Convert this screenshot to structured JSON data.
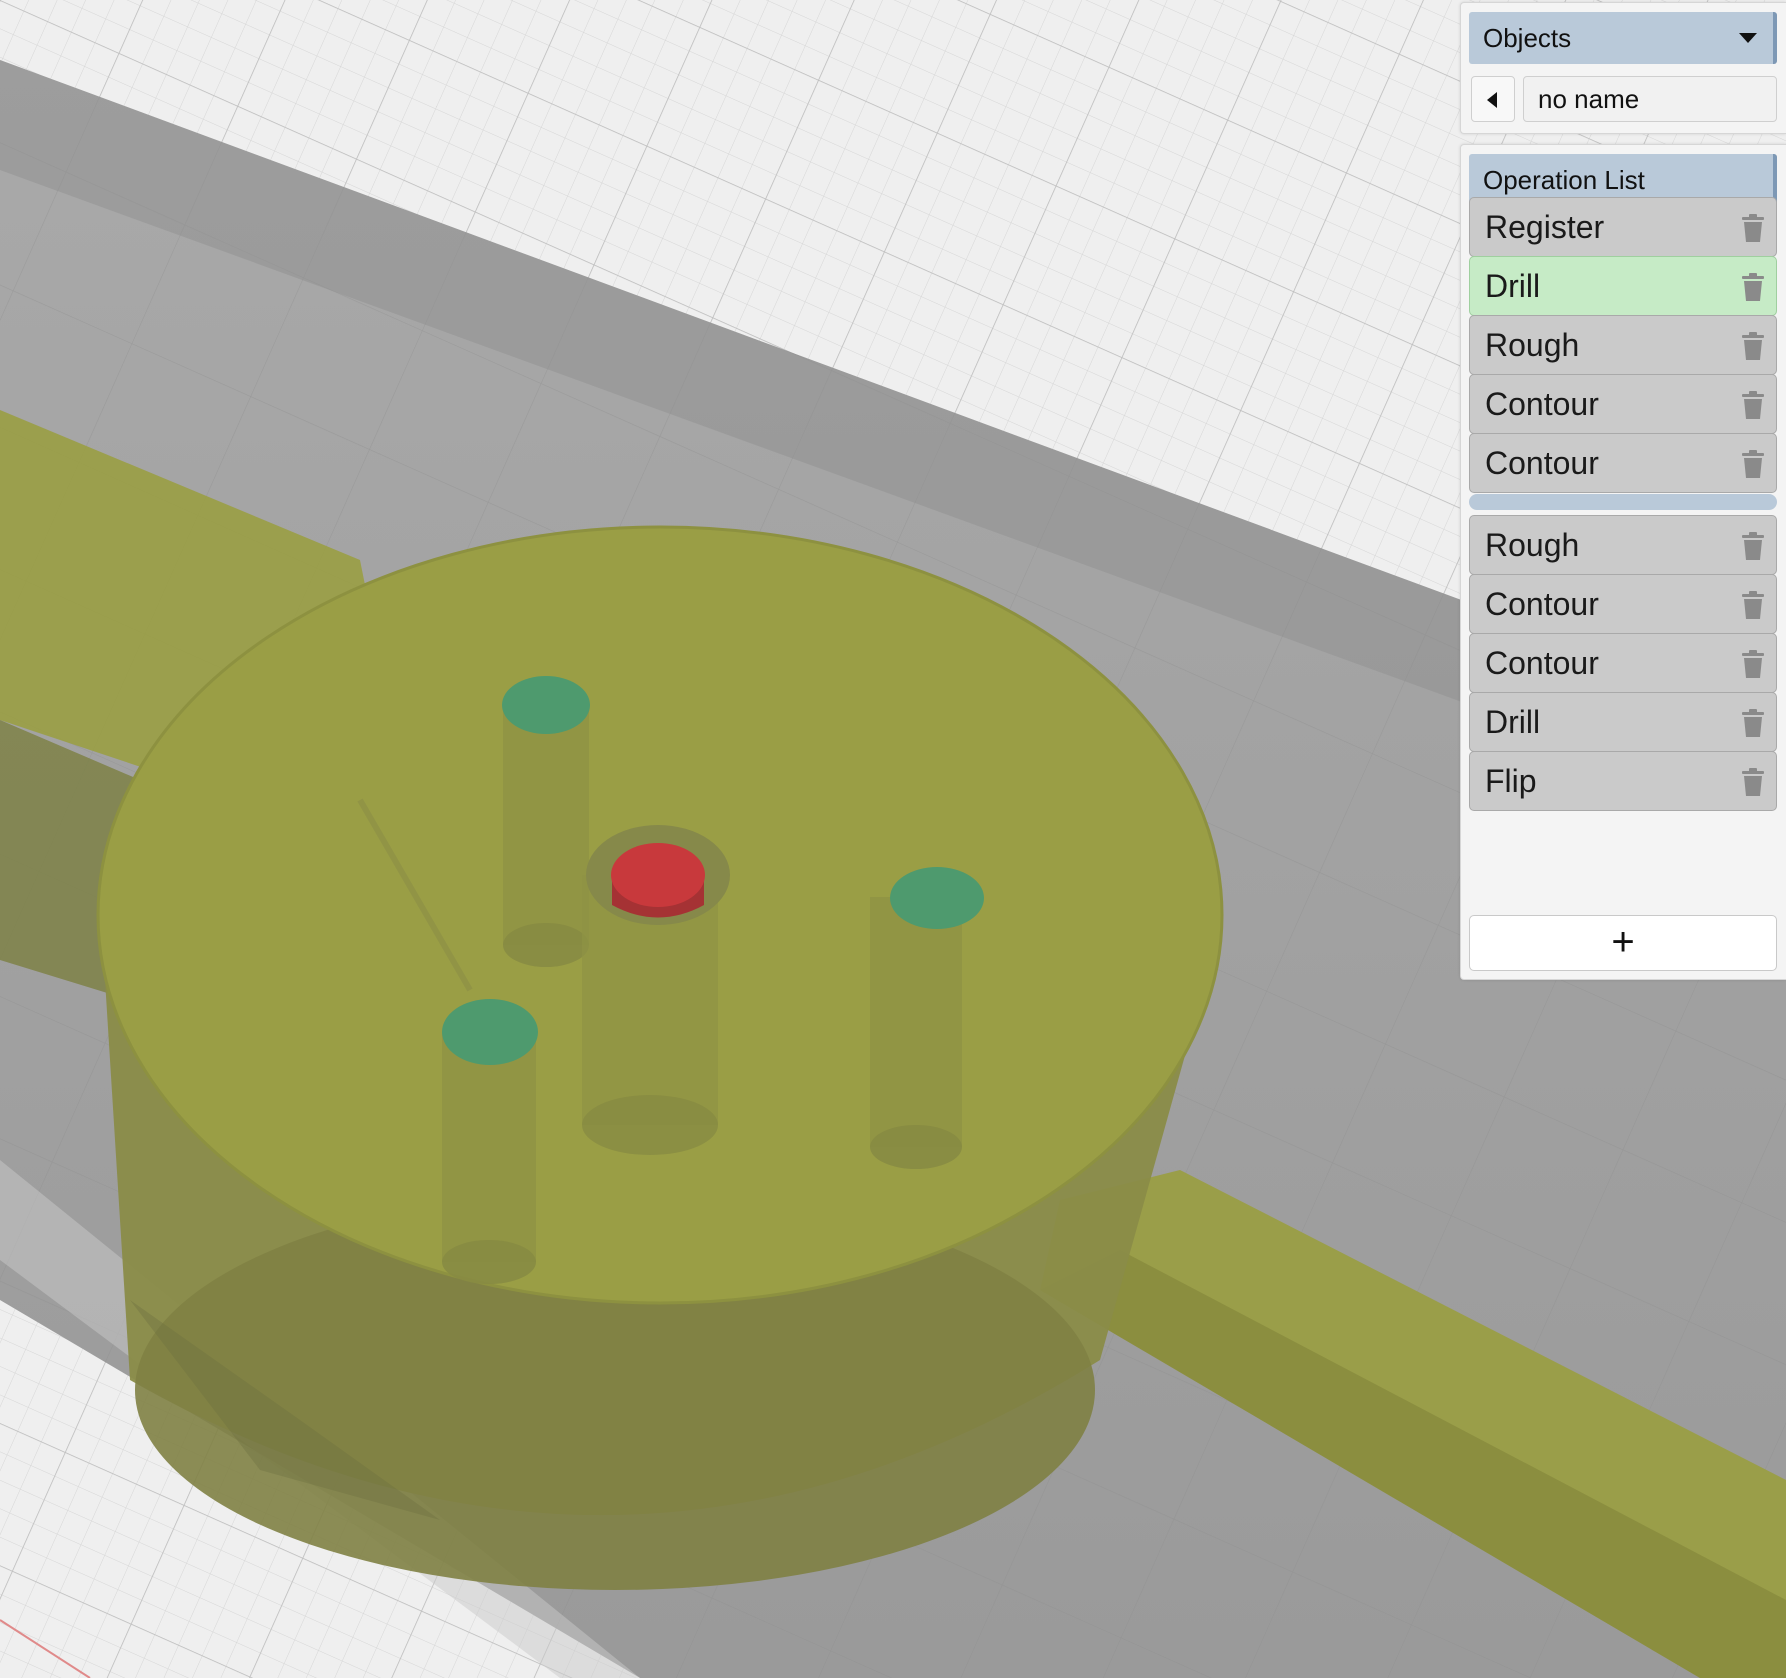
{
  "objects_panel": {
    "title": "Objects",
    "dropdown_icon": "caret-down-icon",
    "prev_icon": "caret-left-icon",
    "name_value": "no name"
  },
  "operations_panel": {
    "title": "Operation List",
    "add_label": "+",
    "delete_icon": "trash-icon",
    "active_color": "#c6ebc6",
    "groups": [
      {
        "items": [
          {
            "label": "Register",
            "active": false
          },
          {
            "label": "Drill",
            "active": true
          },
          {
            "label": "Rough",
            "active": false
          },
          {
            "label": "Contour",
            "active": false
          },
          {
            "label": "Contour",
            "active": false
          }
        ]
      },
      {
        "items": [
          {
            "label": "Rough",
            "active": false
          },
          {
            "label": "Contour",
            "active": false
          },
          {
            "label": "Contour",
            "active": false
          },
          {
            "label": "Drill",
            "active": false
          },
          {
            "label": "Flip",
            "active": false
          }
        ]
      }
    ]
  },
  "viewport": {
    "part_color": "#9a9e45",
    "hole_marker_color": "#4e9a6e",
    "selected_hole_color": "#c8393c",
    "stock_color": "#9c9c9c",
    "grid_color": "#eeeeee"
  }
}
